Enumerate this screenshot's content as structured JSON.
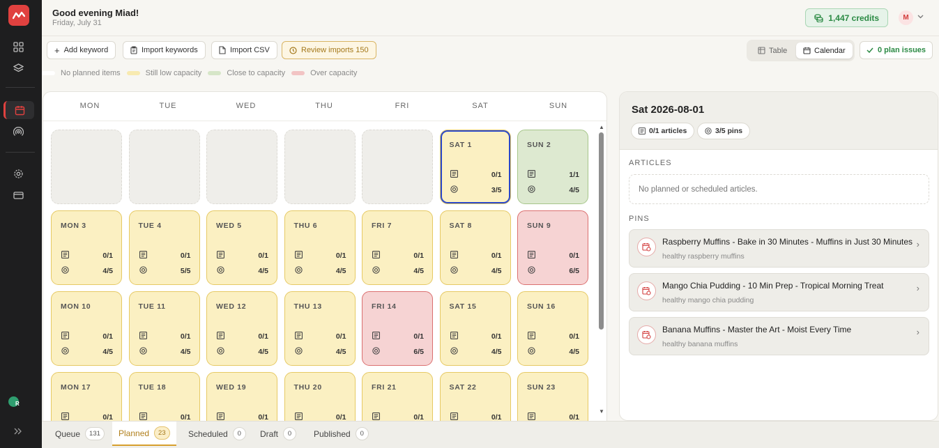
{
  "header": {
    "greeting": "Good evening Miad!",
    "date": "Friday, July 31",
    "credits": "1,447 credits",
    "avatar_initial": "M"
  },
  "toolbar": {
    "add_keyword": "Add keyword",
    "import_keywords": "Import keywords",
    "import_csv": "Import CSV",
    "review_imports": "Review imports 150"
  },
  "view_toggle": {
    "table": "Table",
    "calendar": "Calendar",
    "selected": "Calendar"
  },
  "plan_issues": "0 plan issues",
  "legend": [
    {
      "label": "No planned items",
      "color": "#ffffff"
    },
    {
      "label": "Still low capacity",
      "color": "#f8eab0"
    },
    {
      "label": "Close to capacity",
      "color": "#d6e6c8"
    },
    {
      "label": "Over capacity",
      "color": "#f2c4c4"
    }
  ],
  "calendar": {
    "weekdays": [
      "MON",
      "TUE",
      "WED",
      "THU",
      "FRI",
      "SAT",
      "SUN"
    ],
    "weeks": [
      [
        {
          "empty": true
        },
        {
          "empty": true
        },
        {
          "empty": true
        },
        {
          "empty": true
        },
        {
          "empty": true
        },
        {
          "label": "SAT 1",
          "articles": "0/1",
          "pins": "3/5",
          "status": "low",
          "selected": true
        },
        {
          "label": "SUN 2",
          "articles": "1/1",
          "pins": "4/5",
          "status": "close"
        }
      ],
      [
        {
          "label": "MON 3",
          "articles": "0/1",
          "pins": "4/5",
          "status": "low"
        },
        {
          "label": "TUE 4",
          "articles": "0/1",
          "pins": "5/5",
          "status": "low"
        },
        {
          "label": "WED 5",
          "articles": "0/1",
          "pins": "4/5",
          "status": "low"
        },
        {
          "label": "THU 6",
          "articles": "0/1",
          "pins": "4/5",
          "status": "low"
        },
        {
          "label": "FRI 7",
          "articles": "0/1",
          "pins": "4/5",
          "status": "low"
        },
        {
          "label": "SAT 8",
          "articles": "0/1",
          "pins": "4/5",
          "status": "low"
        },
        {
          "label": "SUN 9",
          "articles": "0/1",
          "pins": "6/5",
          "status": "over"
        }
      ],
      [
        {
          "label": "MON 10",
          "articles": "0/1",
          "pins": "4/5",
          "status": "low"
        },
        {
          "label": "TUE 11",
          "articles": "0/1",
          "pins": "4/5",
          "status": "low"
        },
        {
          "label": "WED 12",
          "articles": "0/1",
          "pins": "4/5",
          "status": "low"
        },
        {
          "label": "THU 13",
          "articles": "0/1",
          "pins": "4/5",
          "status": "low"
        },
        {
          "label": "FRI 14",
          "articles": "0/1",
          "pins": "6/5",
          "status": "over"
        },
        {
          "label": "SAT 15",
          "articles": "0/1",
          "pins": "4/5",
          "status": "low"
        },
        {
          "label": "SUN 16",
          "articles": "0/1",
          "pins": "4/5",
          "status": "low"
        }
      ],
      [
        {
          "label": "MON 17",
          "articles": "0/1",
          "pins": "",
          "status": "low"
        },
        {
          "label": "TUE 18",
          "articles": "0/1",
          "pins": "",
          "status": "low"
        },
        {
          "label": "WED 19",
          "articles": "0/1",
          "pins": "",
          "status": "low"
        },
        {
          "label": "THU 20",
          "articles": "0/1",
          "pins": "",
          "status": "low"
        },
        {
          "label": "FRI 21",
          "articles": "0/1",
          "pins": "",
          "status": "low"
        },
        {
          "label": "SAT 22",
          "articles": "0/1",
          "pins": "",
          "status": "low"
        },
        {
          "label": "SUN 23",
          "articles": "0/1",
          "pins": "",
          "status": "low"
        }
      ]
    ]
  },
  "detail": {
    "title": "Sat 2026-08-01",
    "articles_chip": "0/1 articles",
    "pins_chip": "3/5 pins",
    "articles_heading": "ARTICLES",
    "articles_empty": "No planned or scheduled articles.",
    "pins_heading": "PINS",
    "pins": [
      {
        "title": "Raspberry Muffins - Bake in 30 Minutes - Muffins in Just 30 Minutes",
        "keyword": "healthy raspberry muffins"
      },
      {
        "title": "Mango Chia Pudding - 10 Min Prep - Tropical Morning Treat",
        "keyword": "healthy mango chia pudding"
      },
      {
        "title": "Banana Muffins - Master the Art - Moist Every Time",
        "keyword": "healthy banana muffins"
      }
    ]
  },
  "bottom_tabs": [
    {
      "label": "Queue",
      "count": "131"
    },
    {
      "label": "Planned",
      "count": "23",
      "active": true
    },
    {
      "label": "Scheduled",
      "count": "0"
    },
    {
      "label": "Draft",
      "count": "0"
    },
    {
      "label": "Published",
      "count": "0"
    }
  ],
  "sidebar": {
    "user_initial": "R"
  }
}
